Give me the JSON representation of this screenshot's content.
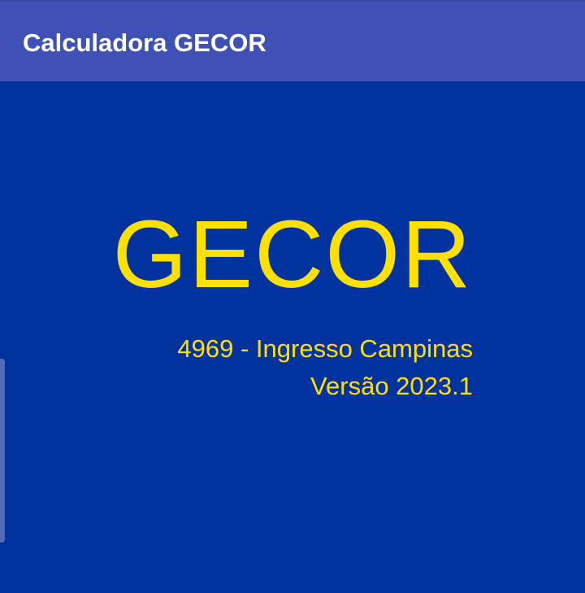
{
  "app_bar": {
    "title": "Calculadora GECOR"
  },
  "main": {
    "brand": "GECOR",
    "subtitle_line1": "4969 - Ingresso Campinas",
    "subtitle_line2": "Versão 2023.1"
  },
  "colors": {
    "app_bar": "#3f51b5",
    "background": "#0033a0",
    "accent_text": "#ffe000",
    "title_text": "#ffffff"
  }
}
